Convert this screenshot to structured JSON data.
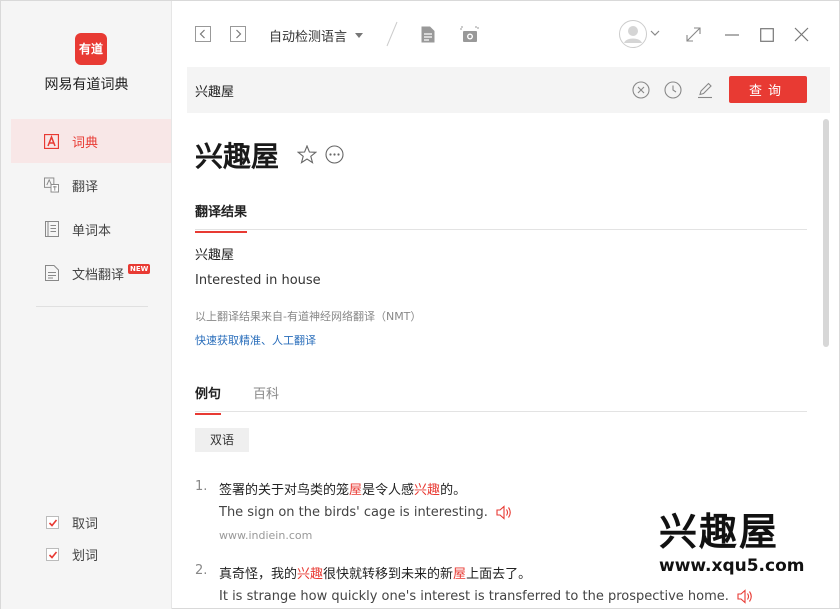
{
  "app": {
    "name": "网易有道词典",
    "logo_text": "有道",
    "accent": "#e83a33"
  },
  "sidebar": {
    "items": [
      {
        "label": "词典",
        "icon": "dictionary-icon",
        "active": true
      },
      {
        "label": "翻译",
        "icon": "translate-icon",
        "active": false
      },
      {
        "label": "单词本",
        "icon": "wordbook-icon",
        "active": false
      },
      {
        "label": "文档翻译",
        "icon": "document-icon",
        "active": false,
        "badge": "NEW"
      }
    ],
    "checks": [
      {
        "label": "取词",
        "checked": true
      },
      {
        "label": "划词",
        "checked": true
      }
    ]
  },
  "toolbar": {
    "language": "自动检测语言",
    "icons": [
      "back-icon",
      "forward-icon",
      "note-icon",
      "screenshot-icon",
      "avatar-icon",
      "shrink-icon",
      "minimize-icon",
      "maximize-icon",
      "close-icon"
    ]
  },
  "search": {
    "value": "兴趣屋",
    "button_label": "查询",
    "icons": [
      "clear-icon",
      "history-icon",
      "edit-icon"
    ]
  },
  "entry": {
    "headword": "兴趣屋",
    "tab_result": "翻译结果",
    "source": "兴趣屋",
    "translation": "Interested in house",
    "note": "以上翻译结果来自-有道神经网络翻译（NMT）",
    "link": "快速获取精准、人工翻译"
  },
  "examples_section": {
    "tabs": [
      "例句",
      "百科"
    ],
    "chip": "双语",
    "items": [
      {
        "num": "1.",
        "zh_parts": [
          "签署的关于对鸟类的笼",
          "屋",
          "是令人感",
          "兴趣",
          "的。"
        ],
        "en": "The sign on the birds' cage is interesting.",
        "source": "www.indiein.com"
      },
      {
        "num": "2.",
        "zh_parts": [
          "真奇怪，我的",
          "兴趣",
          "很快就转移到未来的新",
          "屋",
          "上面去了。"
        ],
        "en": "It is strange how quickly one's interest is transferred to the prospective home."
      }
    ]
  },
  "watermark": {
    "title": "兴趣屋",
    "url": "www.xqu5.com"
  }
}
